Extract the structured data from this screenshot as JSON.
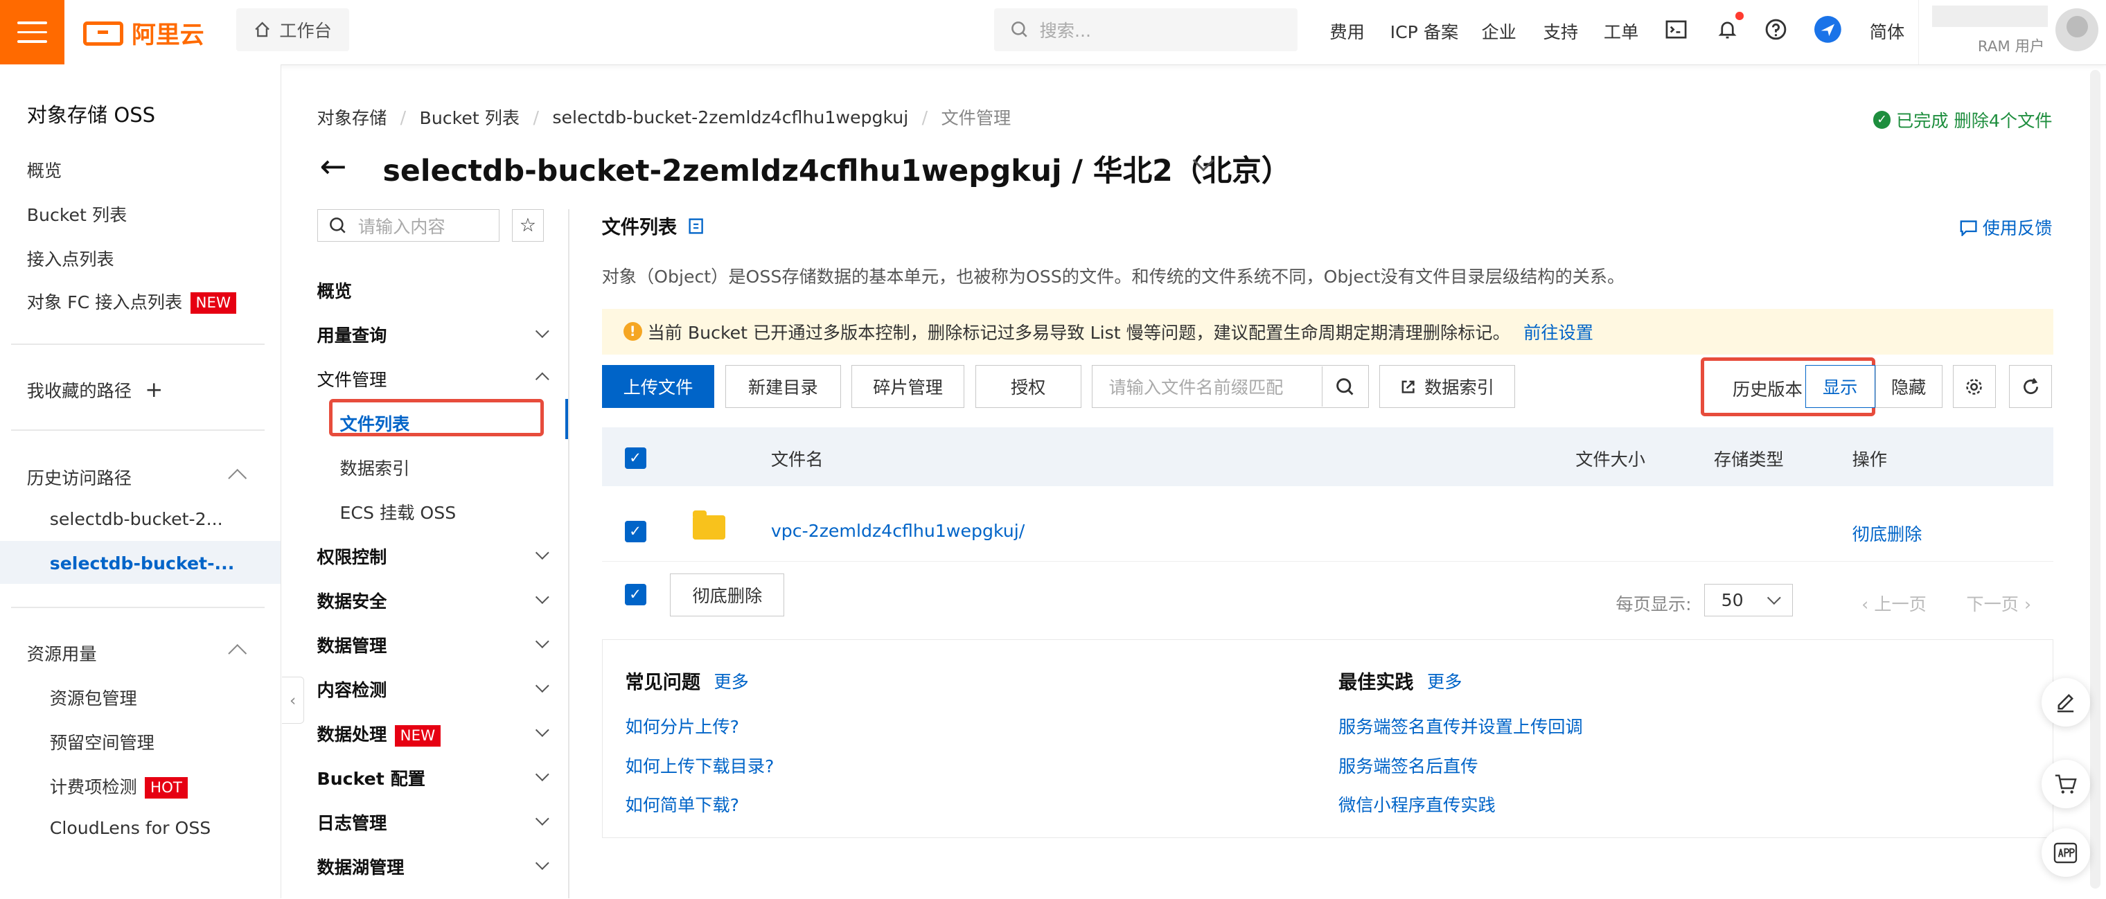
{
  "topbar": {
    "logo_text": "阿里云",
    "workbench": "工作台",
    "search_placeholder": "搜索...",
    "menu": [
      "费用",
      "ICP 备案",
      "企业",
      "支持",
      "工单"
    ],
    "language": "简体",
    "user_role": "RAM 用户"
  },
  "sidebar": {
    "title": "对象存储 OSS",
    "items": [
      "概览",
      "Bucket 列表",
      "接入点列表",
      "对象 FC 接入点列表"
    ],
    "new_badge": "NEW",
    "favorites": "我收藏的路径",
    "history_title": "历史访问路径",
    "history": [
      "selectdb-bucket-2...",
      "selectdb-bucket-..."
    ],
    "resources_title": "资源用量",
    "resources": [
      "资源包管理",
      "预留空间管理",
      "计费项检测",
      "CloudLens for OSS"
    ],
    "hot_badge": "HOT"
  },
  "header": {
    "breadcrumb": [
      "对象存储",
      "Bucket 列表",
      "selectdb-bucket-2zemldz4cflhu1wepgkuj",
      "文件管理"
    ],
    "title": "selectdb-bucket-2zemldz4cflhu1wepgkuj / 华北2（北京）",
    "status": "已完成 删除4个文件"
  },
  "nav": {
    "search_placeholder": "请输入内容",
    "items": [
      "概览",
      "用量查询",
      "文件管理",
      "权限控制",
      "数据安全",
      "数据管理",
      "内容检测",
      "数据处理",
      "Bucket 配置",
      "日志管理",
      "数据湖管理"
    ],
    "file_subs": [
      "文件列表",
      "数据索引",
      "ECS 挂载 OSS"
    ],
    "new_badge": "NEW"
  },
  "main": {
    "section_title": "文件列表",
    "feedback": "使用反馈",
    "description": "对象（Object）是OSS存储数据的基本单元，也被称为OSS的文件。和传统的文件系统不同，Object没有文件目录层级结构的关系。",
    "notice": "当前 Bucket 已开通过多版本控制，删除标记过多易导致 List 慢等问题，建议配置生命周期定期清理删除标记。",
    "notice_link": "前往设置",
    "toolbar": {
      "upload": "上传文件",
      "new_dir": "新建目录",
      "fragments": "碎片管理",
      "authorize": "授权",
      "search_placeholder": "请输入文件名前缀匹配",
      "data_index": "数据索引",
      "history_version": "历史版本",
      "show": "显示",
      "hide": "隐藏"
    },
    "table": {
      "columns": [
        "文件名",
        "文件大小",
        "存储类型",
        "操作"
      ],
      "rows": [
        {
          "name": "vpc-2zemldz4cflhu1wepgkuj/",
          "action": "彻底删除"
        }
      ]
    },
    "bulk_delete": "彻底删除",
    "pagination": {
      "page_size_label": "每页显示:",
      "page_size": "50",
      "prev": "上一页",
      "next": "下一页"
    },
    "help": {
      "faq_title": "常见问题",
      "faq_more": "更多",
      "faq": [
        "如何分片上传?",
        "如何上传下载目录?",
        "如何简单下载?"
      ],
      "best_title": "最佳实践",
      "best_more": "更多",
      "best": [
        "服务端签名直传并设置上传回调",
        "服务端签名后直传",
        "微信小程序直传实践"
      ]
    }
  },
  "colors": {
    "brand": "#ff6a00",
    "primary": "#0064c8",
    "highlight_box": "#e74c3c",
    "success": "#1e8e3e",
    "badge": "#e60012"
  }
}
